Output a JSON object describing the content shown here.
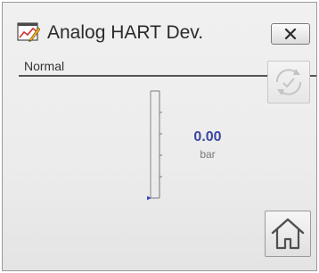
{
  "window": {
    "title": "Analog HART Dev.",
    "app_icon": "trend-chart-edit-icon",
    "close_icon": "close-x-icon"
  },
  "status": {
    "text": "Normal"
  },
  "actions": {
    "reset_icon": "reset-cycle-check-icon",
    "home_icon": "home-icon"
  },
  "measurement": {
    "value": "0.00",
    "unit": "bar",
    "bar_level": 0.0
  },
  "colors": {
    "value_text": "#3a47a0",
    "indicator": "#3a47c0",
    "background": "#ececec"
  }
}
